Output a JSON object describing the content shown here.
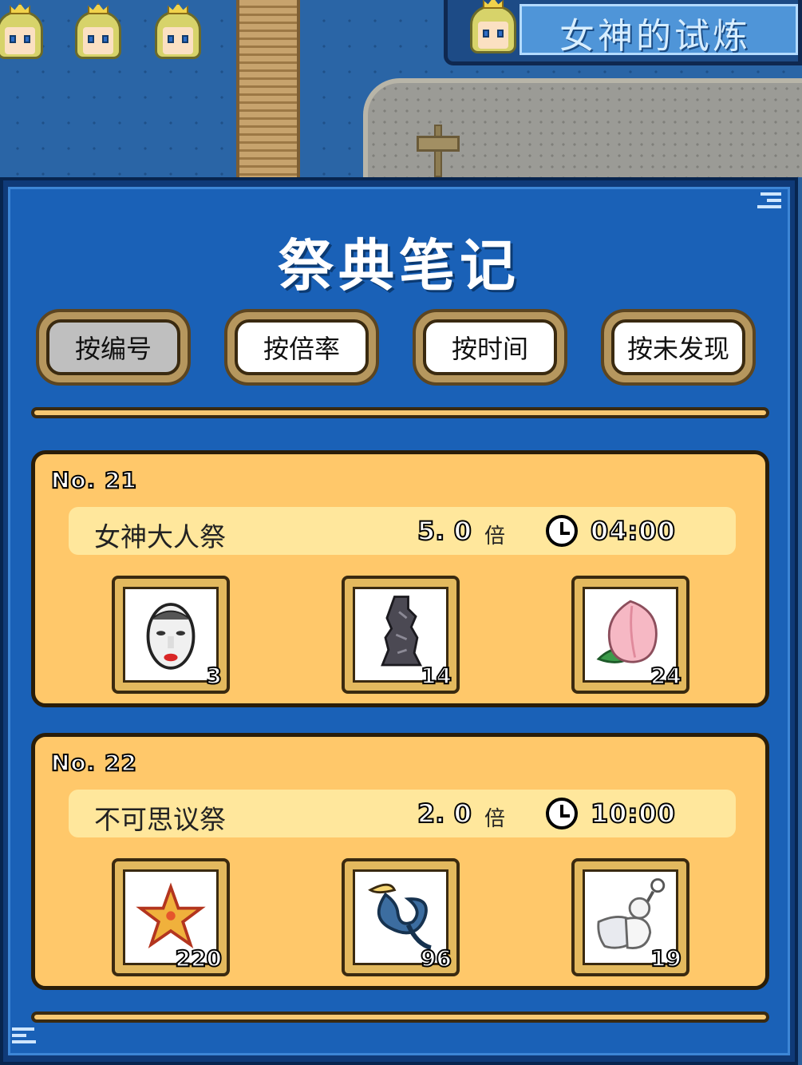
{
  "quest": {
    "title": "女神的试炼"
  },
  "panel": {
    "title": "祭典笔记"
  },
  "sort_buttons": [
    {
      "label": "按编号",
      "active": true
    },
    {
      "label": "按倍率",
      "active": false
    },
    {
      "label": "按时间",
      "active": false
    },
    {
      "label": "按未发现",
      "active": false
    }
  ],
  "festivals": [
    {
      "no": "No. 21",
      "name": "女神大人祭",
      "multiplier": "5. 0",
      "multiplier_unit": "倍",
      "time": "04:00",
      "items": [
        {
          "icon": "mask-icon",
          "count": "3"
        },
        {
          "icon": "statue-icon",
          "count": "14"
        },
        {
          "icon": "peach-icon",
          "count": "24"
        }
      ]
    },
    {
      "no": "No. 22",
      "name": "不可思议祭",
      "multiplier": "2. 0",
      "multiplier_unit": "倍",
      "time": "10:00",
      "items": [
        {
          "icon": "starfish-icon",
          "count": "220"
        },
        {
          "icon": "fishhook-icon",
          "count": "96"
        },
        {
          "icon": "snowman-bottle-icon",
          "count": "19"
        }
      ]
    }
  ]
}
